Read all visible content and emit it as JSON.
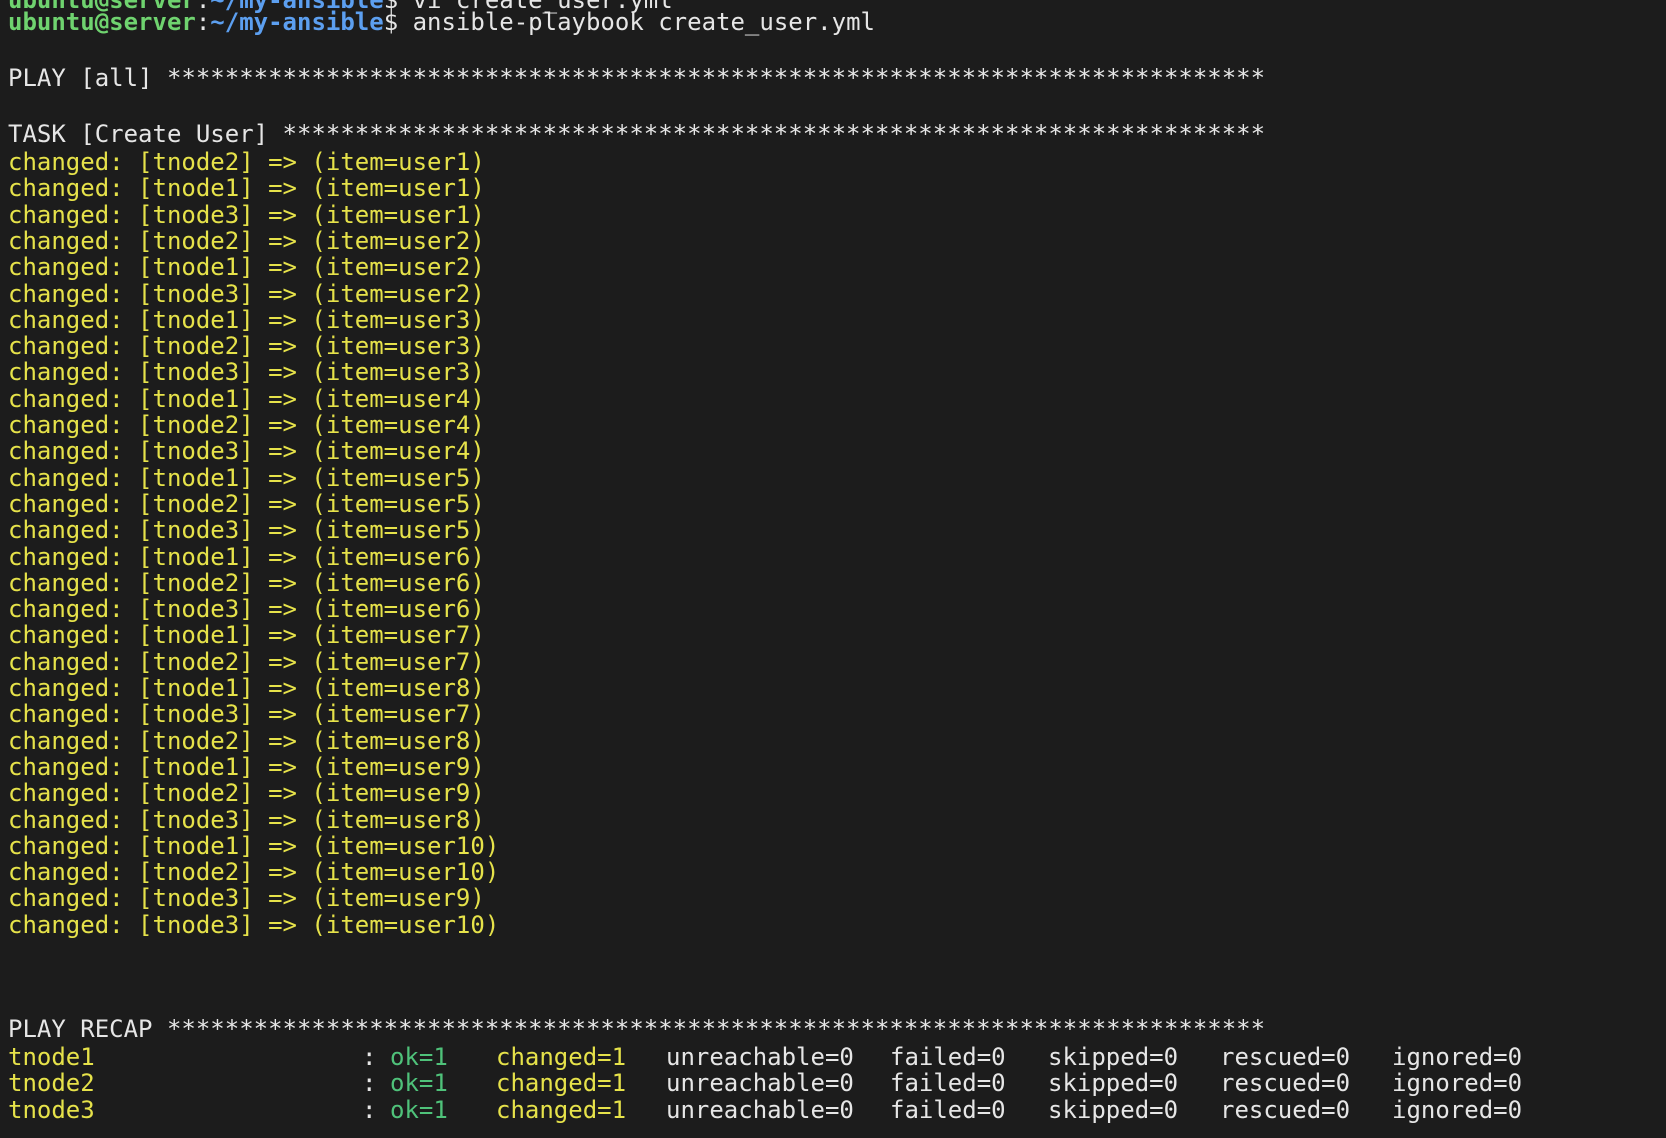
{
  "colors": {
    "background": "#1c1c1c",
    "prompt_user": "#6fd36f",
    "prompt_path": "#5c9ff0",
    "text": "#e6e6e6",
    "changed": "#e6e24a",
    "ok": "#4fc27a"
  },
  "previous_line": {
    "user": "ubuntu@server",
    "sep": ":",
    "path": "~/my-ansible",
    "command": "$ vi create_user.yml"
  },
  "prompt": {
    "user": "ubuntu@server",
    "sep": ":",
    "path": "~/my-ansible",
    "command": "$ ansible-playbook create_user.yml"
  },
  "play_header": "PLAY [all] ****************************************************************************",
  "task_header": "TASK [Create User] ********************************************************************",
  "changed_lines": [
    "changed: [tnode2] => (item=user1)",
    "changed: [tnode1] => (item=user1)",
    "changed: [tnode3] => (item=user1)",
    "changed: [tnode2] => (item=user2)",
    "changed: [tnode1] => (item=user2)",
    "changed: [tnode3] => (item=user2)",
    "changed: [tnode1] => (item=user3)",
    "changed: [tnode2] => (item=user3)",
    "changed: [tnode3] => (item=user3)",
    "changed: [tnode1] => (item=user4)",
    "changed: [tnode2] => (item=user4)",
    "changed: [tnode3] => (item=user4)",
    "changed: [tnode1] => (item=user5)",
    "changed: [tnode2] => (item=user5)",
    "changed: [tnode3] => (item=user5)",
    "changed: [tnode1] => (item=user6)",
    "changed: [tnode2] => (item=user6)",
    "changed: [tnode3] => (item=user6)",
    "changed: [tnode1] => (item=user7)",
    "changed: [tnode2] => (item=user7)",
    "changed: [tnode1] => (item=user8)",
    "changed: [tnode3] => (item=user7)",
    "changed: [tnode2] => (item=user8)",
    "changed: [tnode1] => (item=user9)",
    "changed: [tnode2] => (item=user9)",
    "changed: [tnode3] => (item=user8)",
    "changed: [tnode1] => (item=user10)",
    "changed: [tnode2] => (item=user10)",
    "changed: [tnode3] => (item=user9)",
    "changed: [tnode3] => (item=user10)"
  ],
  "recap_header": "PLAY RECAP ****************************************************************************",
  "recap": [
    {
      "host": "tnode1",
      "colon": ":",
      "ok": "ok=1",
      "changed": "changed=1",
      "unreachable": "unreachable=0",
      "failed": "failed=0",
      "skipped": "skipped=0",
      "rescued": "rescued=0",
      "ignored": "ignored=0"
    },
    {
      "host": "tnode2",
      "colon": ":",
      "ok": "ok=1",
      "changed": "changed=1",
      "unreachable": "unreachable=0",
      "failed": "failed=0",
      "skipped": "skipped=0",
      "rescued": "rescued=0",
      "ignored": "ignored=0"
    },
    {
      "host": "tnode3",
      "colon": ":",
      "ok": "ok=1",
      "changed": "changed=1",
      "unreachable": "unreachable=0",
      "failed": "failed=0",
      "skipped": "skipped=0",
      "rescued": "rescued=0",
      "ignored": "ignored=0"
    }
  ]
}
